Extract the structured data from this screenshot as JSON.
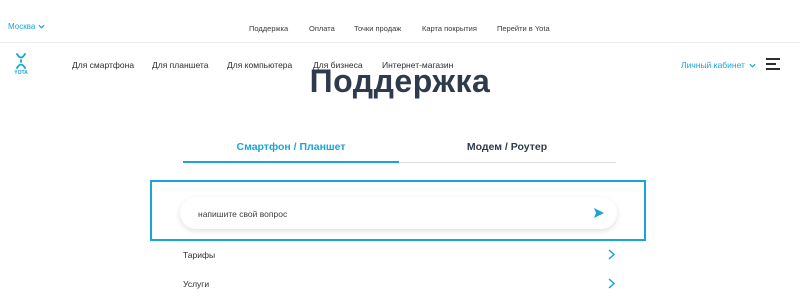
{
  "topbar": {
    "city": "Москва",
    "links": [
      "Поддержка",
      "Оплата",
      "Точки продаж",
      "Карта покрытия",
      "Перейти в Yota"
    ]
  },
  "logo": {
    "text": "YOTA"
  },
  "nav": {
    "links": [
      "Для смартфона",
      "Для планшета",
      "Для компьютера",
      "Для бизнеса",
      "Интернет-магазин"
    ],
    "cabinet": "Личный кабинет"
  },
  "page": {
    "title": "Поддержка"
  },
  "tabs": [
    {
      "label": "Смартфон / Планшет",
      "active": true
    },
    {
      "label": "Модем / Роутер",
      "active": false
    }
  ],
  "search": {
    "placeholder": "напишите свой вопрос",
    "value": ""
  },
  "faq": [
    {
      "label": "Тарифы"
    },
    {
      "label": "Услуги"
    }
  ],
  "colors": {
    "accent": "#1aa5d9",
    "heading": "#2f3b4c",
    "text": "#2e2e2e"
  },
  "icons": [
    "chevron-down-icon",
    "yota-logo-icon",
    "menu-icon",
    "send-icon",
    "chevron-right-icon"
  ]
}
